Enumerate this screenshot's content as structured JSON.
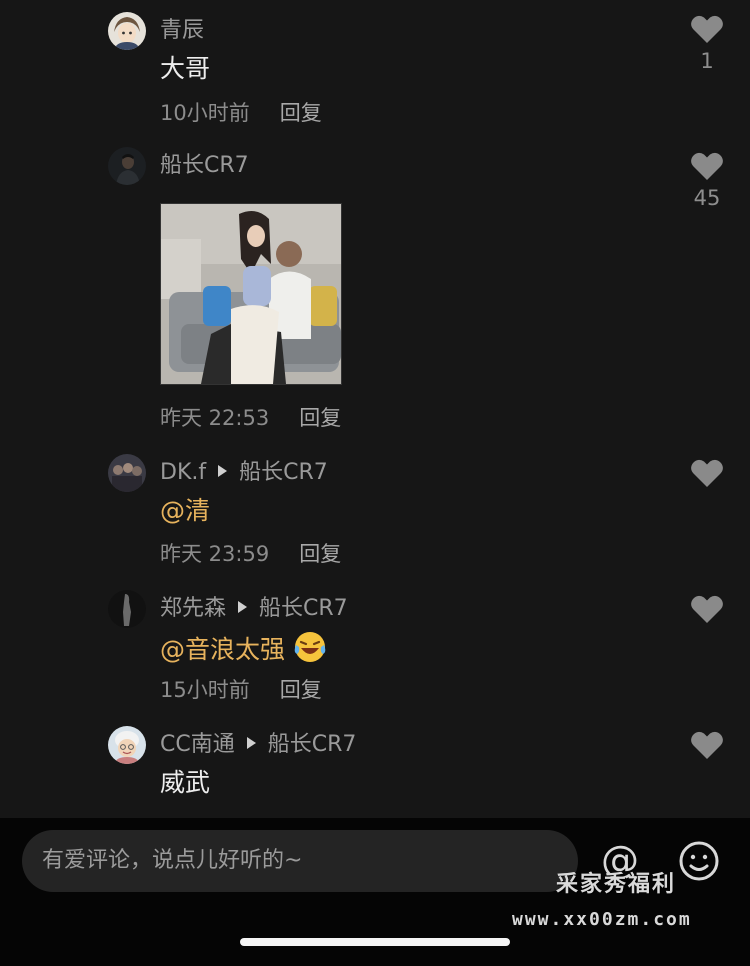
{
  "comments": [
    {
      "user": "青辰",
      "text": "大哥",
      "time": "10小时前",
      "reply": "回复",
      "likes": "1",
      "avatar_icon": "anime-character-avatar-icon"
    },
    {
      "user": "船长CR7",
      "photo_icon": "couple-on-sofa-photo",
      "time": "昨天 22:53",
      "reply": "回复",
      "likes": "45",
      "avatar_icon": "dark-portrait-avatar-icon"
    },
    {
      "user": "DK.f",
      "reply_to": "船长CR7",
      "mention": "@清",
      "time": "昨天 23:59",
      "reply": "回复",
      "avatar_icon": "group-photo-avatar-icon"
    },
    {
      "user": "郑先森",
      "reply_to": "船长CR7",
      "mention": "@音浪太强",
      "emoji_icon": "laughing-tears-emoji-icon",
      "time": "15小时前",
      "reply": "回复",
      "avatar_icon": "silhouette-avatar-icon"
    },
    {
      "user": "CC南通",
      "reply_to": "船长CR7",
      "text": "威武",
      "avatar_icon": "cartoon-grandma-avatar-icon"
    }
  ],
  "input": {
    "placeholder": "有爱评论，说点儿好听的~"
  },
  "toolbar": {
    "at_symbol": "@",
    "emoji_button_icon": "smiley-face-icon"
  },
  "watermark": {
    "name": "采家秀福利",
    "url": "www.xx00zm.com"
  },
  "colors": {
    "background": "#161616",
    "mention": "#e7b35d",
    "secondary_text": "#8c8c8c",
    "like_icon": "#8a8a8a"
  }
}
